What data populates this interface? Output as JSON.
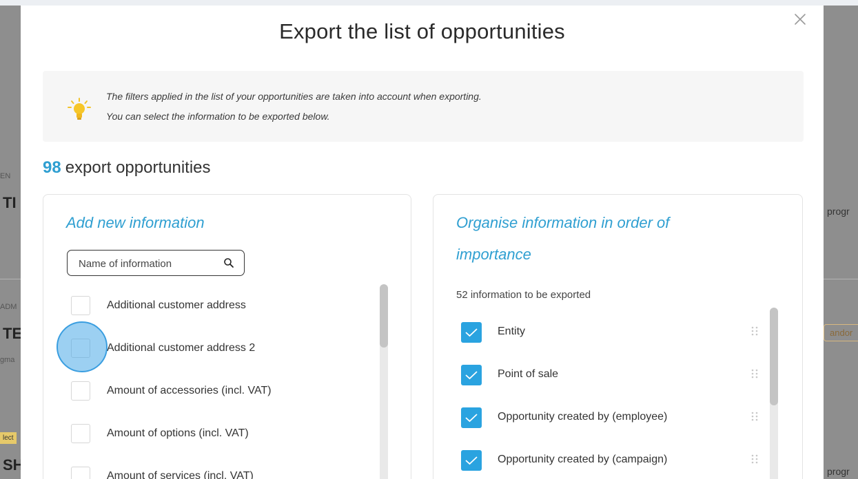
{
  "background": {
    "left_fragments": [
      "EN",
      "TI",
      "ADM",
      "TES",
      "gma",
      "lect",
      "SH"
    ],
    "right_fragments": [
      "progr",
      "andor",
      "progr"
    ]
  },
  "modal": {
    "title": "Export the list of opportunities",
    "close_icon": "close-icon",
    "info": {
      "icon": "lightbulb-icon",
      "line1": "The filters applied in the list of your opportunities are taken into account when exporting.",
      "line2": "You can select the information to be exported below."
    },
    "count": {
      "value": "98",
      "label": "export opportunities"
    },
    "left_panel": {
      "title": "Add new information",
      "search_placeholder": "Name of information",
      "items": [
        {
          "label": "Additional customer address",
          "checked": false
        },
        {
          "label": "Additional customer address 2",
          "checked": false
        },
        {
          "label": "Amount of accessories (incl. VAT)",
          "checked": false
        },
        {
          "label": "Amount of options (incl. VAT)",
          "checked": false
        },
        {
          "label": "Amount of services (incl. VAT)",
          "checked": false
        }
      ]
    },
    "right_panel": {
      "title_line1": "Organise information in order of",
      "title_line2": "importance",
      "subtitle": "52 information to be exported",
      "items": [
        {
          "label": "Entity",
          "checked": true
        },
        {
          "label": "Point of sale",
          "checked": true
        },
        {
          "label": "Opportunity created by (employee)",
          "checked": true
        },
        {
          "label": "Opportunity created by (campaign)",
          "checked": true
        }
      ]
    }
  },
  "colors": {
    "accent": "#2f9fd1",
    "checkbox": "#2aa3e0",
    "highlight": "#4aaae8"
  }
}
